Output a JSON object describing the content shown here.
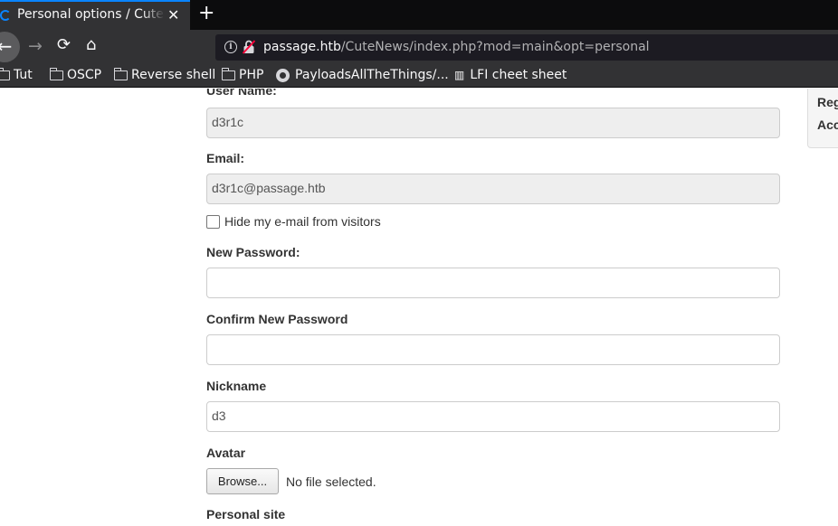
{
  "browser": {
    "tab_title": "Personal options / CuteNews",
    "tab_close": "✕",
    "new_tab": "+",
    "url_host": "passage.htb",
    "url_path": "/CuteNews/index.php?mod=main&opt=personal",
    "bookmarks": [
      {
        "label": "Tut",
        "icon": "folder-icon"
      },
      {
        "label": "OSCP",
        "icon": "folder-icon"
      },
      {
        "label": "Reverse shell",
        "icon": "folder-icon"
      },
      {
        "label": "PHP",
        "icon": "folder-icon"
      },
      {
        "label": "PayloadsAllTheThings/...",
        "icon": "github-icon"
      },
      {
        "label": "LFI cheet sheet",
        "icon": "map-icon"
      }
    ]
  },
  "form": {
    "username_label": "User Name:",
    "username_value": "d3r1c",
    "email_label": "Email:",
    "email_value": "d3r1c@passage.htb",
    "hide_email_label": "Hide my e-mail from visitors",
    "hide_email_checked": false,
    "new_password_label": "New Password:",
    "new_password_value": "",
    "confirm_password_label": "Confirm New Password",
    "confirm_password_value": "",
    "nickname_label": "Nickname",
    "nickname_value": "d3",
    "avatar_label": "Avatar",
    "browse_label": "Browse...",
    "no_file_label": "No file selected.",
    "personal_site_label": "Personal site"
  },
  "side_panel": {
    "items": [
      "Reg",
      "Acc"
    ]
  },
  "colors": {
    "tab_accent": "#0a84ff",
    "chrome_bg": "#323234",
    "readonly_field": "#eeeeee"
  }
}
